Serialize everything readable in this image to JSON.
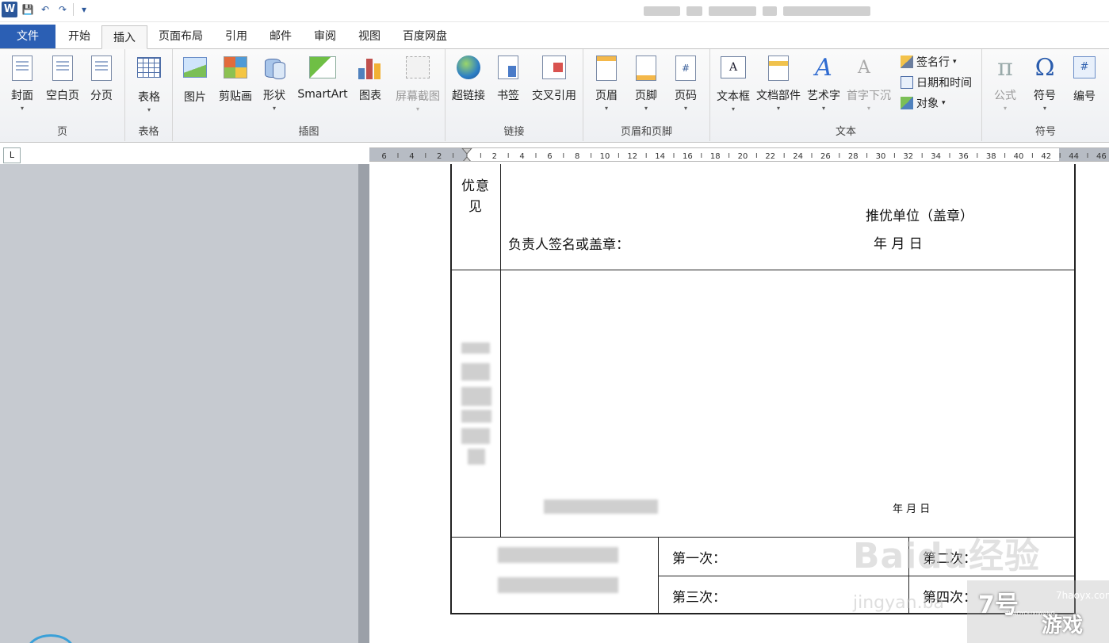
{
  "qat": {
    "logo": "W",
    "save": "💾",
    "undo": "↶",
    "redo": "↷",
    "customize": "▾"
  },
  "tabs": [
    {
      "label": "文件"
    },
    {
      "label": "开始"
    },
    {
      "label": "插入"
    },
    {
      "label": "页面布局"
    },
    {
      "label": "引用"
    },
    {
      "label": "邮件"
    },
    {
      "label": "审阅"
    },
    {
      "label": "视图"
    },
    {
      "label": "百度网盘"
    }
  ],
  "ribbon": {
    "groups": {
      "page": "页",
      "table": "表格",
      "illustrations": "插图",
      "links": "链接",
      "header_footer": "页眉和页脚",
      "text": "文本",
      "symbols": "符号"
    },
    "buttons": {
      "cover": "封面",
      "blank": "空白页",
      "pagebreak": "分页",
      "table": "表格",
      "picture": "图片",
      "clipart": "剪贴画",
      "shapes": "形状",
      "smartart": "SmartArt",
      "chart": "图表",
      "screenshot": "屏幕截图",
      "hyperlink": "超链接",
      "bookmark": "书签",
      "crossref": "交叉引用",
      "header": "页眉",
      "footer": "页脚",
      "pagenum": "页码",
      "textbox": "文本框",
      "quickparts": "文档部件",
      "wordart": "艺术字",
      "dropcap": "首字下沉",
      "signature": "签名行",
      "datetime": "日期和时间",
      "object": "对象",
      "equation": "公式",
      "symbol": "符号",
      "number": "编号"
    },
    "dropdown_glyph": "▾",
    "icon_text": {
      "textbox": "A",
      "wordart": "A",
      "dropcap": "A",
      "equation": "π",
      "symbol": "Ω",
      "number": "#",
      "pagenum": "#"
    }
  },
  "ruler": {
    "corner": "L"
  },
  "document": {
    "left_col_top": [
      "优",
      "意",
      "见"
    ],
    "unit": "推优单位（盖章）",
    "signer": "负责人签名或盖章：",
    "date_large": "年     月     日",
    "date_small": "年     月     日",
    "first": "第一次：",
    "second": "第二次：",
    "third": "第三次：",
    "fourth": "第四次："
  },
  "watermarks": {
    "baidu": "Baidu经验",
    "jingyan": "jingyan.ba",
    "game_big": "7号",
    "game_small": "游戏",
    "game_url": "7haoyx.com",
    "game_pinyin": "7HAOYOUXIWANG"
  }
}
